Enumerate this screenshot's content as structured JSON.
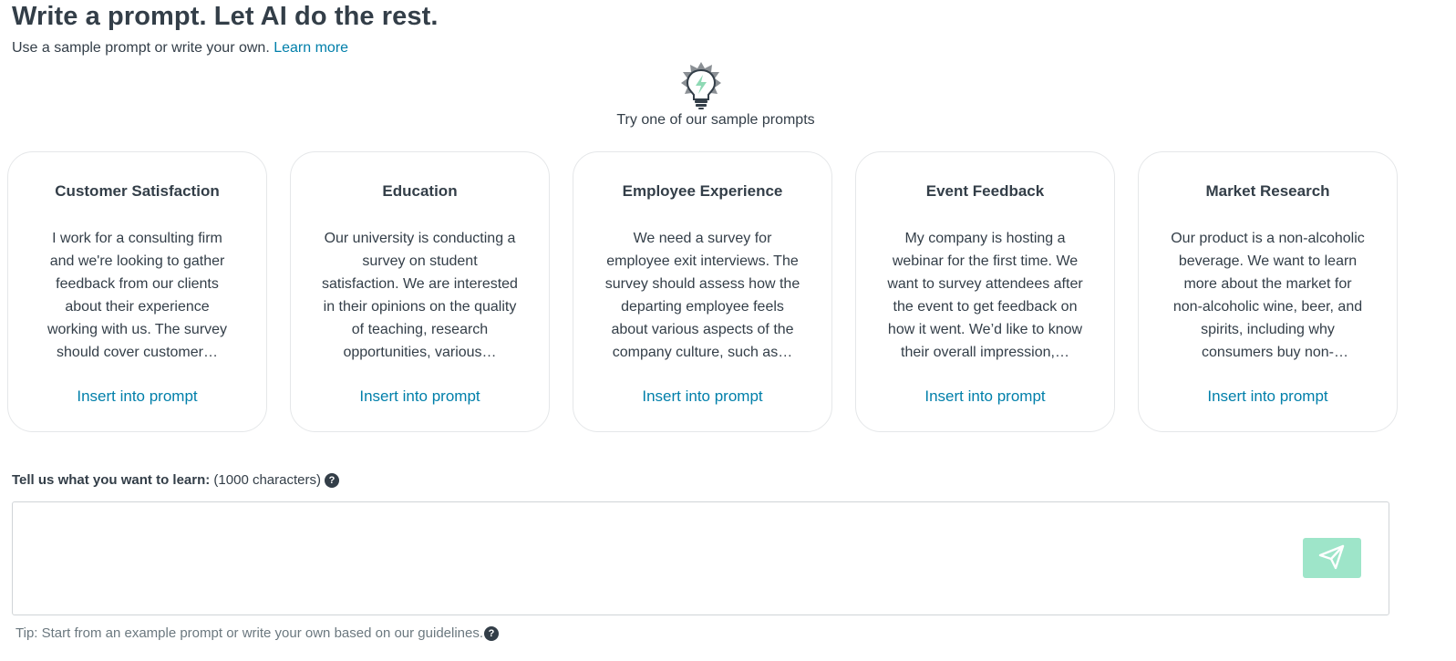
{
  "header": {
    "title": "Write a prompt. Let AI do the rest.",
    "subtitle": "Use a sample prompt or write your own.",
    "learn_more": "Learn more"
  },
  "samples": {
    "heading": "Try one of our sample prompts",
    "icon": "lightbulb-icon",
    "cards": [
      {
        "title": "Customer Satisfaction",
        "text": "I work for a consulting firm and we're looking to gather feedback from our clients about their experience working with us. The survey should cover customer…",
        "action": "Insert into prompt"
      },
      {
        "title": "Education",
        "text": "Our university is conducting a survey on student satisfaction. We are interested in their opinions on the quality of teaching, research opportunities, various…",
        "action": "Insert into prompt"
      },
      {
        "title": "Employee Experience",
        "text": "We need a survey for employee exit interviews. The survey should assess how the departing employee feels about various aspects of the company culture, such as…",
        "action": "Insert into prompt"
      },
      {
        "title": "Event Feedback",
        "text": "My company is hosting a webinar for the first time. We want to survey attendees after the event to get feedback on how it went. We’d like to know their overall impression,…",
        "action": "Insert into prompt"
      },
      {
        "title": "Market Research",
        "text": "Our product is a non-alcoholic beverage. We want to learn more about the market for non-alcoholic wine, beer, and spirits, including why consumers buy non-alcoholi…",
        "action": "Insert into prompt"
      }
    ]
  },
  "prompt": {
    "label_bold": "Tell us what you want to learn:",
    "label_hint": "(1000 characters)",
    "value": "",
    "placeholder": "",
    "send_icon": "send-icon",
    "tip": "Tip: Start from an example prompt or write your own based on our guidelines."
  },
  "colors": {
    "text": "#333e48",
    "link": "#007faa",
    "send_button": "#9ee5c9",
    "bulb_accent": "#8ed9b4"
  }
}
